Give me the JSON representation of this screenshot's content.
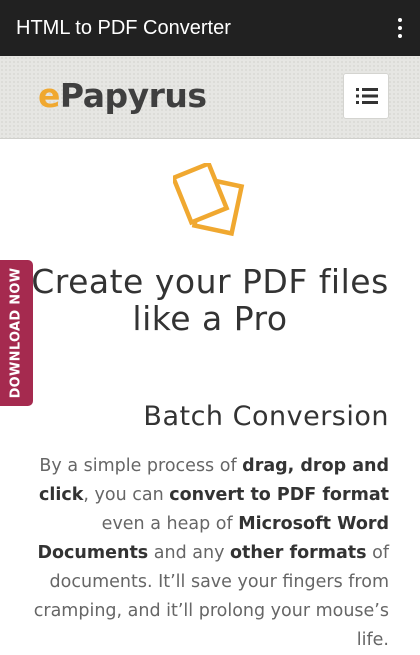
{
  "appbar": {
    "title": "HTML to PDF Converter"
  },
  "header": {
    "logo_first": "e",
    "logo_rest": "Papyrus"
  },
  "hero": {
    "line1": "Create your PDF files",
    "line2": "like a Pro"
  },
  "section": {
    "title": "Batch Conversion",
    "t1": "By a simple process of ",
    "b1": "drag, drop and click",
    "t2": ", you can ",
    "b2": "convert to PDF format",
    "t3": " even a heap of ",
    "b3": "Microsoft Word Documents",
    "t4": " and any ",
    "b4": "other formats",
    "t5": " of documents. It’ll save your fingers from cramping, and it’ll prolong your mouse’s life."
  },
  "download_tab": {
    "label": "DOWNLOAD NOW"
  },
  "colors": {
    "brand_orange": "#f0a830",
    "tab_maroon": "#a52a4f",
    "appbar": "#212121"
  },
  "icons": [
    "more-vert-icon",
    "menu-list-icon",
    "documents-icon"
  ]
}
